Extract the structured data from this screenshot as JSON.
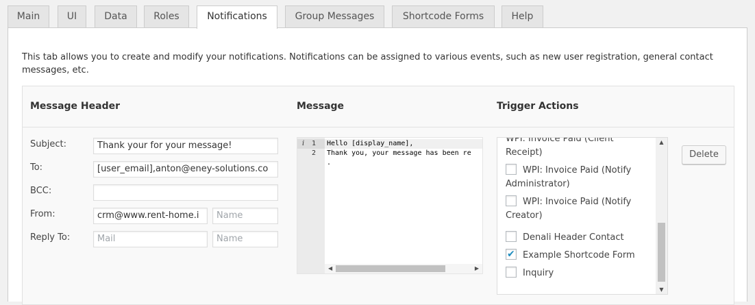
{
  "tabs": [
    "Main",
    "UI",
    "Data",
    "Roles",
    "Notifications",
    "Group Messages",
    "Shortcode Forms",
    "Help"
  ],
  "active_tab": "Notifications",
  "intro": "This tab allows you to create and modify your notifications. Notifications can be assigned to various events, such as new user registration, general contact messages, etc.",
  "table": {
    "col_header": "Message Header",
    "col_message": "Message",
    "col_trigger": "Trigger Actions"
  },
  "fields": {
    "subject_label": "Subject:",
    "subject_value": "Thank your for your message!",
    "to_label": "To:",
    "to_value": "[user_email],anton@eney-solutions.co",
    "bcc_label": "BCC:",
    "bcc_value": "",
    "from_label": "From:",
    "from_value": "crm@www.rent-home.i",
    "from_name_placeholder": "Name",
    "reply_label": "Reply To:",
    "reply_mail_placeholder": "Mail",
    "reply_name_placeholder": "Name"
  },
  "editor": {
    "gutter_icon": "i",
    "lines": [
      {
        "num": "1",
        "text": "Hello [display_name],"
      },
      {
        "num": "2",
        "text": "Thank you, your message has been re"
      },
      {
        "num": "",
        "text": "."
      }
    ]
  },
  "triggers": [
    {
      "label": "WPI: Invoice Paid (Client Receipt)",
      "checked": false
    },
    {
      "label": "WPI: Invoice Paid (Notify Administrator)",
      "checked": false
    },
    {
      "label": "WPI: Invoice Paid (Notify Creator)",
      "checked": false
    },
    {
      "label": "Denali Header Contact",
      "checked": false
    },
    {
      "label": "Example Shortcode Form",
      "checked": true
    },
    {
      "label": "Inquiry",
      "checked": false
    }
  ],
  "delete_label": "Delete",
  "icons": {
    "scroll_up": "arrow-up-icon",
    "scroll_down": "arrow-down-icon",
    "scroll_left": "arrow-left-icon",
    "scroll_right": "arrow-right-icon",
    "checkmark": "checkmark-icon"
  },
  "colors": {
    "accent": "#1e8cbe",
    "page_bg": "#f1f1f1",
    "border": "#cccccc"
  }
}
